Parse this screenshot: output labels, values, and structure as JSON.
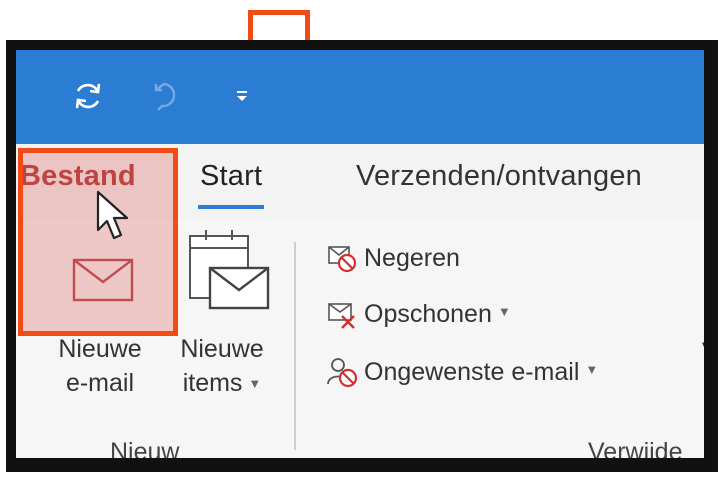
{
  "qat": {
    "icons": [
      "sync-icon",
      "undo-icon",
      "customize-qat-icon"
    ]
  },
  "tabs": {
    "file": "Bestand",
    "start": "Start",
    "send_receive": "Verzenden/ontvangen"
  },
  "ribbon": {
    "new_group": {
      "label": "Nieuw",
      "new_mail": {
        "line1": "Nieuwe",
        "line2": "e-mail"
      },
      "new_items": {
        "line1": "Nieuwe",
        "line2": "items"
      }
    },
    "delete_group": {
      "label_visible": "Verwijde",
      "ignore": "Negeren",
      "cleanup": "Opschonen",
      "junk": "Ongewenste e-mail"
    },
    "cut_text": "V"
  },
  "colors": {
    "accent": "#2b7cd3",
    "highlight_border": "#f24c16",
    "file_tab": "#b43a36"
  }
}
